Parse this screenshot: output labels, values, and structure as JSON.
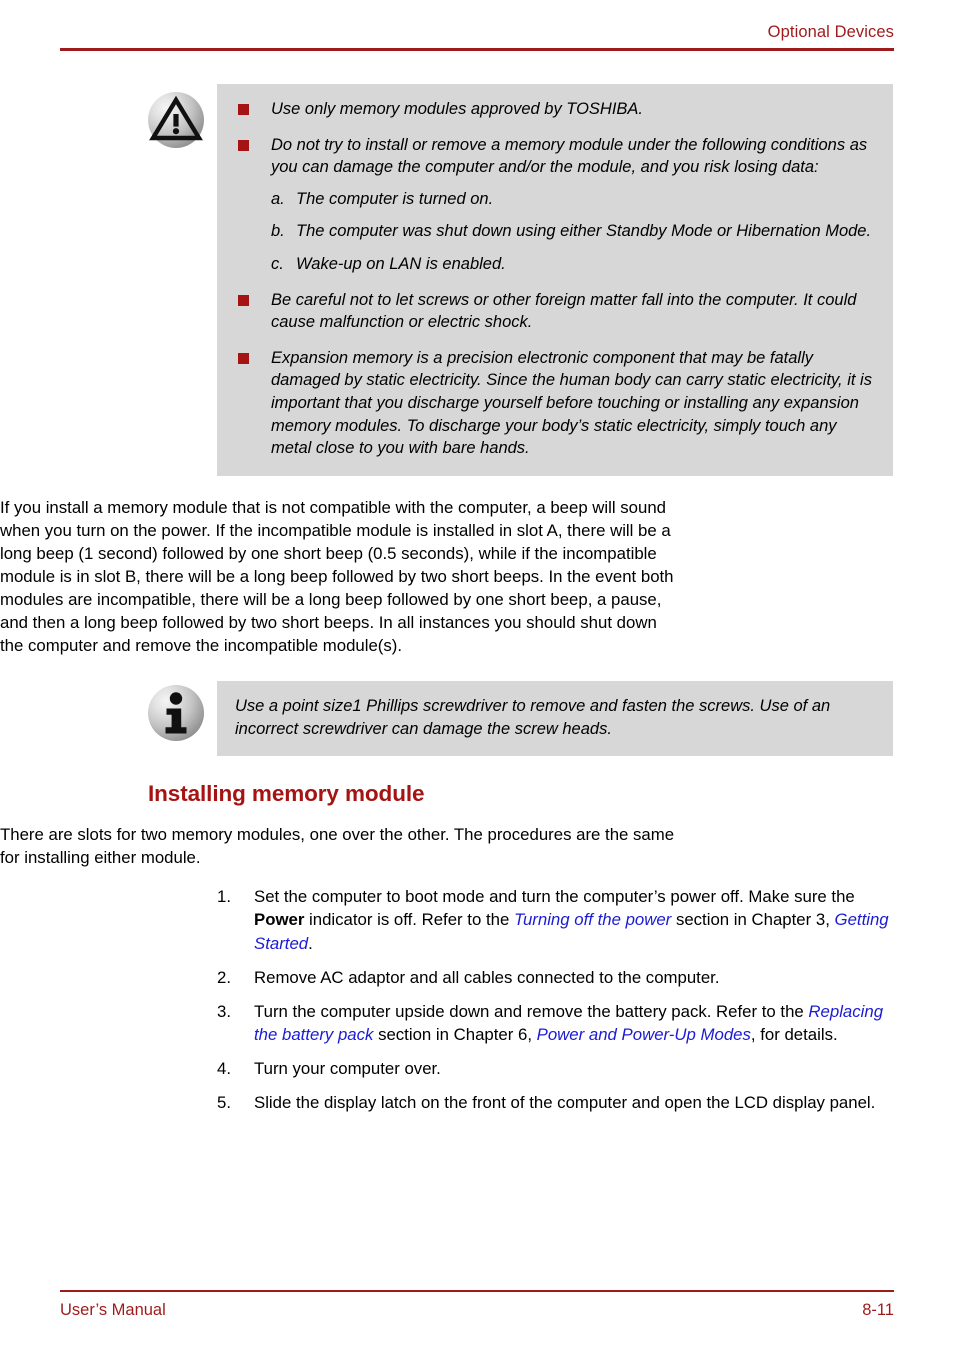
{
  "header": {
    "title": "Optional Devices"
  },
  "warning_notice": {
    "icon": "warning-triangle-icon",
    "items": [
      {
        "text": "Use only memory modules approved by TOSHIBA."
      },
      {
        "text": "Do not try to install or remove a memory module under the following conditions as you can damage the computer and/or the module, and you risk losing data:",
        "sub_items": [
          {
            "marker": "a.",
            "text": "The computer is turned on."
          },
          {
            "marker": "b.",
            "text": "The computer was shut down using either Standby Mode or Hibernation Mode."
          },
          {
            "marker": "c.",
            "text": "Wake-up on LAN is enabled."
          }
        ]
      },
      {
        "text": "Be careful not to let screws or other foreign matter fall into the computer. It could cause malfunction or electric shock."
      },
      {
        "text": "Expansion memory is a precision electronic component that may be fatally damaged by static electricity. Since the human body can carry static electricity, it is important that you discharge yourself before touching or installing any expansion memory modules. To discharge your body’s static electricity, simply touch any metal close to you with bare hands."
      }
    ]
  },
  "body": {
    "paragraph_beep": "If you install a memory module that is not compatible with the computer, a beep will sound when you turn on the power. If the incompatible module is installed in slot A, there will be a long beep (1 second) followed by one short beep (0.5 seconds), while if the incompatible module is in slot B, there will be a long beep followed by two short beeps. In the event both modules are incompatible, there will be a long beep followed by one short beep, a pause, and then a long beep followed by two short beeps. In all instances you should shut down the computer and remove the incompatible module(s)."
  },
  "info_notice": {
    "icon": "info-i-icon",
    "text": "Use a point size1 Phillips screwdriver to remove and fasten the screws. Use of an incorrect screwdriver can damage the screw heads."
  },
  "section": {
    "heading": "Installing memory module",
    "intro": "There are slots for two memory modules, one over the other. The procedures are the same for installing either module.",
    "steps": [
      {
        "number": "1.",
        "segments": [
          {
            "type": "text",
            "text": "Set the computer to boot mode and turn the computer’s power off. Make sure the "
          },
          {
            "type": "bold",
            "text": "Power"
          },
          {
            "type": "text",
            "text": " indicator is off. Refer to the "
          },
          {
            "type": "link",
            "text": "Turning off the power"
          },
          {
            "type": "text",
            "text": " section in Chapter 3, "
          },
          {
            "type": "link",
            "text": "Getting Started"
          },
          {
            "type": "text",
            "text": "."
          }
        ]
      },
      {
        "number": "2.",
        "segments": [
          {
            "type": "text",
            "text": "Remove AC adaptor and all cables connected to the computer."
          }
        ]
      },
      {
        "number": "3.",
        "segments": [
          {
            "type": "text",
            "text": "Turn the computer upside down and remove the battery pack. Refer to the "
          },
          {
            "type": "link",
            "text": "Replacing the battery pack"
          },
          {
            "type": "text",
            "text": " section in Chapter 6, "
          },
          {
            "type": "link",
            "text": "Power and Power-Up Modes"
          },
          {
            "type": "text",
            "text": ", for details."
          }
        ]
      },
      {
        "number": "4.",
        "segments": [
          {
            "type": "text",
            "text": "Turn your computer over."
          }
        ]
      },
      {
        "number": "5.",
        "segments": [
          {
            "type": "text",
            "text": "Slide the display latch on the front of the computer and open the LCD display panel."
          }
        ]
      }
    ]
  },
  "footer": {
    "left": "User’s Manual",
    "right": "8-11"
  },
  "colors": {
    "brand_red": "#9e1b1b",
    "heading_red": "#a51313",
    "link_blue": "#1b1bd4",
    "notice_bg": "#d7d7d7"
  }
}
